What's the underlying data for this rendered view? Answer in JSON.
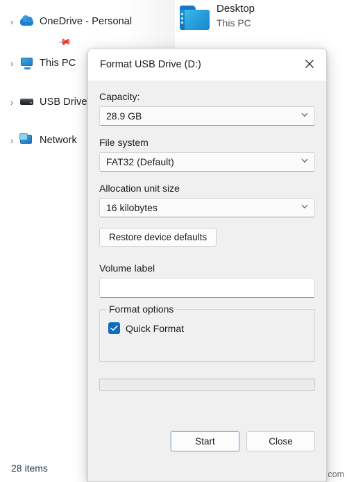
{
  "explorer": {
    "nav_items": [
      {
        "label": "OneDrive - Personal",
        "icon": "cloud-icon",
        "expander": "›"
      },
      {
        "label": "This PC",
        "icon": "monitor-icon",
        "expander": "›"
      },
      {
        "label": "USB Drive (D:)",
        "icon": "drive-icon",
        "expander": "›"
      },
      {
        "label": "Network",
        "icon": "network-icon",
        "expander": "›"
      }
    ],
    "tile": {
      "title": "Desktop",
      "subtitle": "This PC",
      "pin_glyph": "📌"
    },
    "status": "28 items",
    "watermark": "wsxdn.com"
  },
  "dialog": {
    "title": "Format USB Drive (D:)",
    "close_label": "✕",
    "capacity": {
      "label": "Capacity:",
      "value": "28.9 GB"
    },
    "file_system": {
      "label": "File system",
      "value": "FAT32 (Default)"
    },
    "allocation_unit": {
      "label": "Allocation unit size",
      "value": "16 kilobytes"
    },
    "restore_button": "Restore device defaults",
    "volume_label": {
      "label": "Volume label",
      "value": "",
      "placeholder": ""
    },
    "format_options": {
      "legend": "Format options",
      "quick_format": {
        "label": "Quick Format",
        "checked": true
      }
    },
    "progress": {
      "value": 0
    },
    "start_button": "Start",
    "close_button": "Close",
    "accent_color": "#0f6cbd"
  }
}
